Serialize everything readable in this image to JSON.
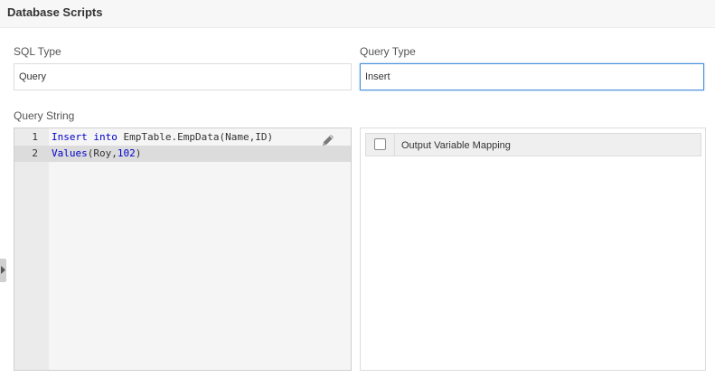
{
  "header": {
    "title": "Database Scripts"
  },
  "sql_type": {
    "label": "SQL Type",
    "value": "Query"
  },
  "query_type": {
    "label": "Query Type",
    "value": "Insert"
  },
  "query_string": {
    "label": "Query String",
    "lines": [
      {
        "number": "1",
        "tokens": [
          {
            "text": "Insert",
            "kind": "keyword"
          },
          {
            "text": " ",
            "kind": "plain"
          },
          {
            "text": "into",
            "kind": "keyword"
          },
          {
            "text": " EmpTable.EmpData(Name,ID)",
            "kind": "plain"
          }
        ]
      },
      {
        "number": "2",
        "tokens": [
          {
            "text": "Values",
            "kind": "keyword"
          },
          {
            "text": "(Roy,",
            "kind": "plain"
          },
          {
            "text": "102",
            "kind": "number"
          },
          {
            "text": ")",
            "kind": "plain"
          }
        ]
      }
    ],
    "active_line": 2,
    "edit_icon": "pencil-icon"
  },
  "mapping": {
    "column_label": "Output Variable Mapping",
    "select_all_checked": false
  },
  "colors": {
    "keyword": "#0000cc",
    "focus_border": "#4a90d9"
  }
}
